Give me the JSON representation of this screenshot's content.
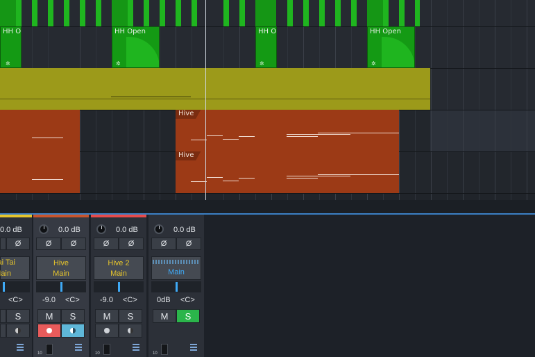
{
  "arrange": {
    "clips_top_labels": [
      "HH O",
      "HH Open",
      "HH O",
      "HH Open"
    ],
    "region_labels": [
      "Hive",
      "Hive"
    ]
  },
  "colors": {
    "green_clip": "#1e9e1e",
    "olive_clip": "#9c9a1a",
    "orange_clip": "#9c3a16",
    "accent_blue": "#3b7fc4",
    "solo_green": "#2bb54b",
    "record_red": "#e85b5b",
    "monitor_blue": "#5fb7d8"
  },
  "mixer": {
    "strips": [
      {
        "volume": "0.0 dB",
        "phase_l": "Ø",
        "phase_r": "Ø",
        "name": "ai Tai",
        "output": "Main",
        "pan_value": "",
        "pan_label": "<C>",
        "mute": "M",
        "solo": "S"
      },
      {
        "volume": "0.0 dB",
        "phase_l": "Ø",
        "phase_r": "Ø",
        "name": "Hive",
        "output": "Main",
        "pan_value": "-9.0",
        "pan_label": "<C>",
        "mute": "M",
        "solo": "S"
      },
      {
        "volume": "0.0 dB",
        "phase_l": "Ø",
        "phase_r": "Ø",
        "name": "Hive 2",
        "output": "Main",
        "pan_value": "-9.0",
        "pan_label": "<C>",
        "mute": "M",
        "solo": "S"
      },
      {
        "volume": "0.0 dB",
        "phase_l": "Ø",
        "phase_r": "Ø",
        "name": "",
        "output": "Main",
        "pan_value": "0dB",
        "pan_label": "<C>",
        "mute": "M",
        "solo": "S"
      }
    ],
    "fader_scale": "10"
  }
}
